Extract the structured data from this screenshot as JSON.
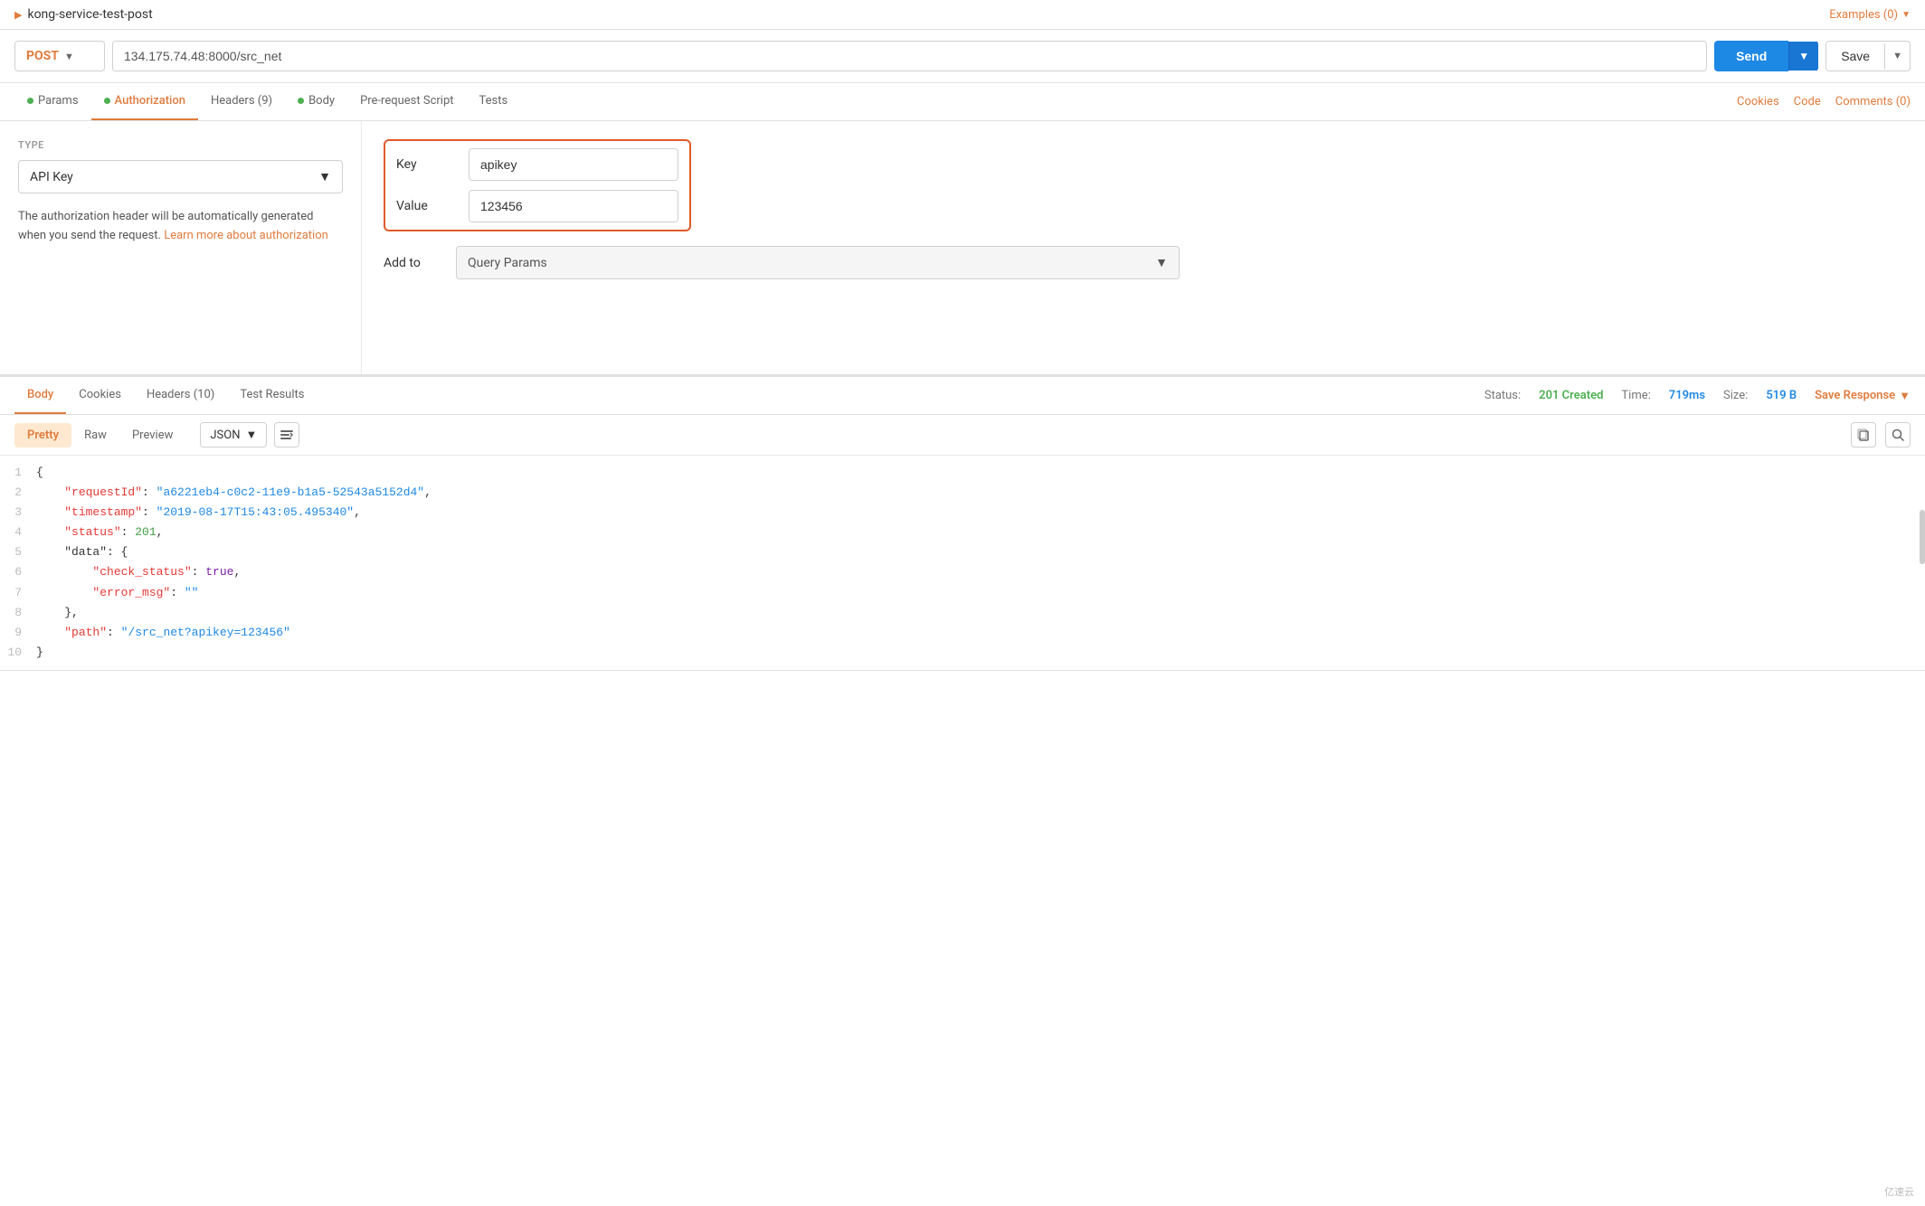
{
  "topbar": {
    "collection_name": "kong-service-test-post",
    "arrow": "▶",
    "examples_label": "Examples (0)",
    "examples_chevron": "▼"
  },
  "urlbar": {
    "method": "POST",
    "method_chevron": "▼",
    "url": "134.175.74.48:8000/src_net",
    "send_label": "Send",
    "send_chevron": "▼",
    "save_label": "Save",
    "save_chevron": "▼"
  },
  "request_tabs": {
    "items": [
      {
        "id": "params",
        "label": "Params",
        "dot": "green",
        "active": false
      },
      {
        "id": "authorization",
        "label": "Authorization",
        "dot": "green",
        "active": true
      },
      {
        "id": "headers",
        "label": "Headers (9)",
        "dot": null,
        "active": false
      },
      {
        "id": "body",
        "label": "Body",
        "dot": "green",
        "active": false
      },
      {
        "id": "pre-request",
        "label": "Pre-request Script",
        "dot": null,
        "active": false
      },
      {
        "id": "tests",
        "label": "Tests",
        "dot": null,
        "active": false
      }
    ],
    "right_items": [
      "Cookies",
      "Code",
      "Comments (0)"
    ]
  },
  "auth": {
    "type_label": "TYPE",
    "type_value": "API Key",
    "type_chevron": "▼",
    "description": "The authorization header will be automatically generated when you send the request.",
    "learn_more_text": "Learn more about authorization",
    "fields": {
      "key_label": "Key",
      "key_value": "apikey",
      "value_label": "Value",
      "value_value": "123456",
      "add_to_label": "Add to",
      "add_to_value": "Query Params",
      "add_to_chevron": "▼"
    }
  },
  "response": {
    "tabs": [
      "Body",
      "Cookies",
      "Headers (10)",
      "Test Results"
    ],
    "active_tab": "Body",
    "status_label": "Status:",
    "status_value": "201 Created",
    "time_label": "Time:",
    "time_value": "719ms",
    "size_label": "Size:",
    "size_value": "519 B",
    "save_response": "Save Response",
    "save_chevron": "▼"
  },
  "body_toolbar": {
    "format_tabs": [
      "Pretty",
      "Raw",
      "Preview"
    ],
    "active_format": "Pretty",
    "format_select": "JSON",
    "format_chevron": "▼"
  },
  "code": {
    "lines": [
      {
        "num": 1,
        "content": "{",
        "type": "brace"
      },
      {
        "num": 2,
        "content": "    \"requestId\": \"a6221eb4-c0c2-11e9-b1a5-52543a5152d4\",",
        "type": "kv_string"
      },
      {
        "num": 3,
        "content": "    \"timestamp\": \"2019-08-17T15:43:05.495340\",",
        "type": "kv_string"
      },
      {
        "num": 4,
        "content": "    \"status\": 201,",
        "type": "kv_number"
      },
      {
        "num": 5,
        "content": "    \"data\": {",
        "type": "kv_brace"
      },
      {
        "num": 6,
        "content": "        \"check_status\": true,",
        "type": "kv_bool"
      },
      {
        "num": 7,
        "content": "        \"error_msg\": \"\"",
        "type": "kv_string"
      },
      {
        "num": 8,
        "content": "    },",
        "type": "brace"
      },
      {
        "num": 9,
        "content": "    \"path\": \"/src_net?apikey=123456\"",
        "type": "kv_string"
      },
      {
        "num": 10,
        "content": "}",
        "type": "brace"
      }
    ]
  },
  "watermark": "亿速云"
}
